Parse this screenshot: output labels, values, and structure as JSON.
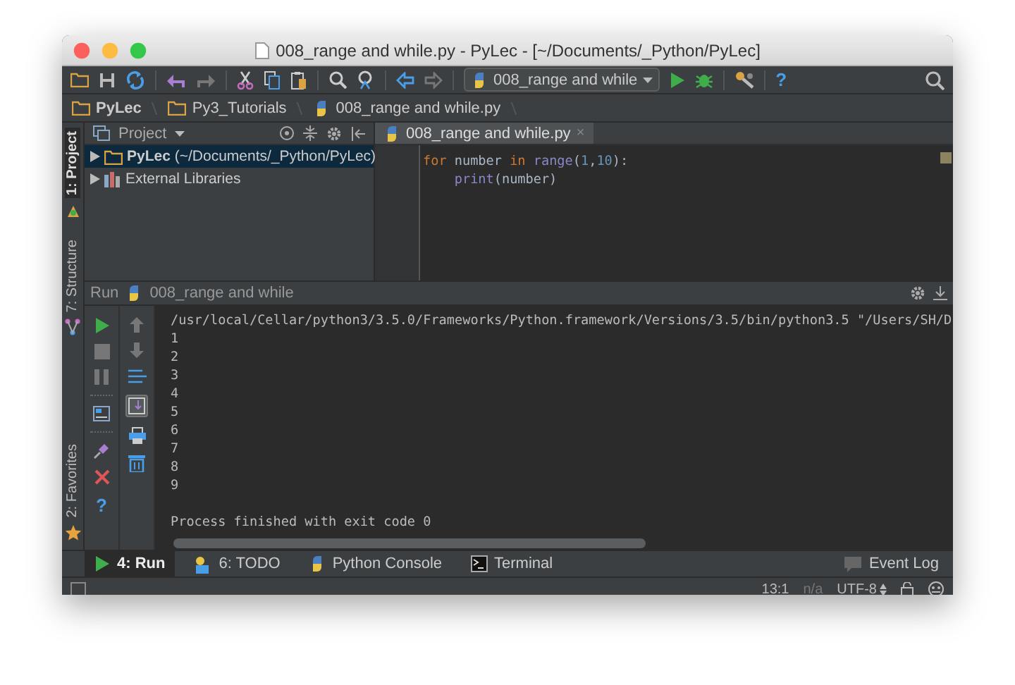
{
  "window": {
    "title": "008_range and while.py - PyLec - [~/Documents/_Python/PyLec]"
  },
  "toolbar": {
    "run_config": "008_range and while",
    "help": "?"
  },
  "breadcrumbs": [
    {
      "label": "PyLec",
      "kind": "folder"
    },
    {
      "label": "Py3_Tutorials",
      "kind": "folder"
    },
    {
      "label": "008_range and while.py",
      "kind": "python"
    }
  ],
  "left_stripe": [
    {
      "label": "1: Project",
      "kind": "project",
      "selected": true
    },
    {
      "label": "7: Structure",
      "kind": "structure",
      "selected": false
    },
    {
      "label": "2: Favorites",
      "kind": "favorites",
      "selected": false
    }
  ],
  "project_panel": {
    "title": "Project",
    "tree": [
      {
        "label": "**PyLec** (~/Documents/_Python/PyLec)",
        "kind": "folder",
        "selected": true,
        "expanded": false
      },
      {
        "label": "External Libraries",
        "kind": "library",
        "selected": false,
        "expanded": false
      }
    ]
  },
  "editor": {
    "tabs": [
      {
        "label": "008_range and while.py",
        "close": "×",
        "selected": true
      }
    ],
    "lines": [
      [
        {
          "kind": "keyword",
          "text": "for"
        },
        {
          "kind": "plain",
          "text": " number "
        },
        {
          "kind": "keyword",
          "text": "in"
        },
        {
          "kind": "builtin",
          "text": " range"
        },
        {
          "kind": "plain",
          "text": "("
        },
        {
          "kind": "number",
          "text": "1"
        },
        {
          "kind": "plain",
          "text": ","
        },
        {
          "kind": "number",
          "text": "10"
        },
        {
          "kind": "plain",
          "text": "):"
        }
      ],
      [
        {
          "kind": "builtin",
          "text": "    print"
        },
        {
          "kind": "plain",
          "text": "(number)"
        }
      ]
    ]
  },
  "run_panel": {
    "title": "Run",
    "config": "008_range and while",
    "help": "?",
    "output": [
      "/usr/local/Cellar/python3/3.5.0/Frameworks/Python.framework/Versions/3.5/bin/python3.5 \"/Users/SH/D",
      "1",
      "2",
      "3",
      "4",
      "5",
      "6",
      "7",
      "8",
      "9"
    ],
    "exit_message": "Process finished with exit code 0"
  },
  "tool_tabs": [
    {
      "label": "4: Run",
      "kind": "run",
      "selected": true
    },
    {
      "label": "6: TODO",
      "kind": "todo",
      "selected": false
    },
    {
      "label": "Python Console",
      "kind": "python",
      "selected": false
    },
    {
      "label": "Terminal",
      "kind": "terminal",
      "selected": false
    }
  ],
  "event_log": "Event Log",
  "status_bar": {
    "position": "13:1",
    "na": "n/a",
    "encoding": "UTF-8"
  }
}
